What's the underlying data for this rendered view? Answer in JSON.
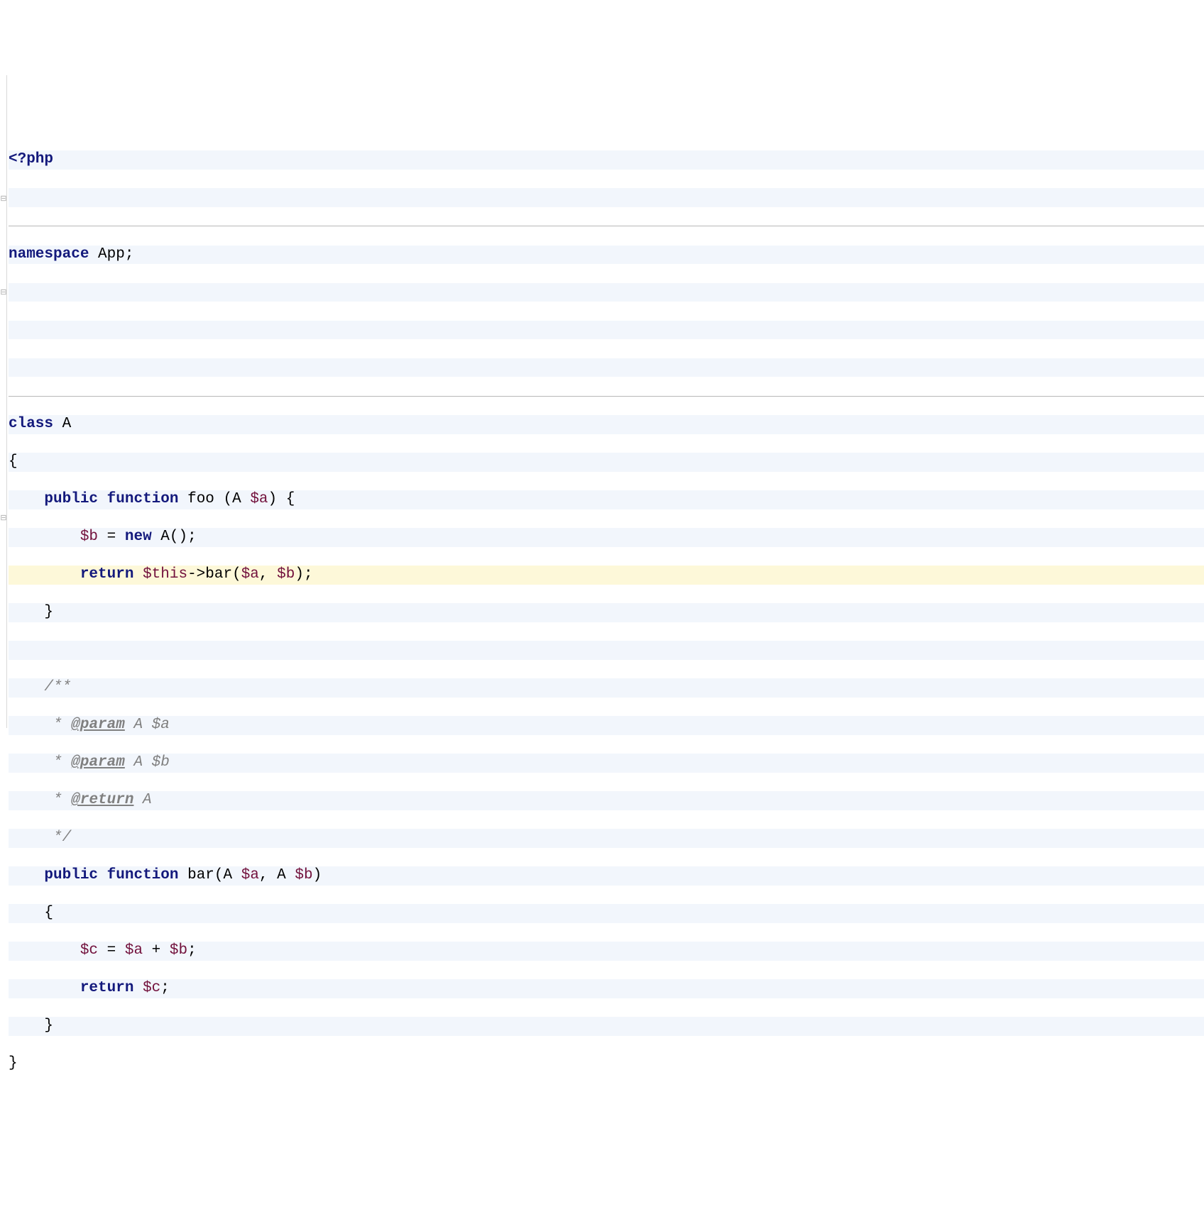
{
  "code": {
    "open_tag": "<?php",
    "ns_kw": "namespace",
    "ns_name": " App;",
    "class_kw": "class",
    "class_name": " A",
    "brace_open": "{",
    "foo_indent": "    ",
    "public_kw": "public",
    "sp": " ",
    "function_kw": "function",
    "foo_name": " foo ",
    "foo_params_open": "(A ",
    "foo_param_a": "$a",
    "foo_params_close": ") {",
    "foo_body_indent": "        ",
    "foo_b_var": "$b",
    "foo_b_eq": " = ",
    "new_kw": "new",
    "foo_b_rest": " A();",
    "return_kw": "return",
    "foo_ret_sp": " ",
    "foo_this": "$this",
    "foo_arrow": "->bar(",
    "foo_arg_a": "$a",
    "foo_comma": ", ",
    "foo_arg_b": "$b",
    "foo_call_close": ");",
    "foo_close_indent": "    ",
    "foo_close_brace": "}",
    "doc_indent": "    ",
    "doc_open": "/**",
    "doc_star_indent": "     ",
    "doc_star": "* ",
    "doc_param_tag": "@param",
    "doc_param_a": " A $a",
    "doc_param_b": " A $b",
    "doc_return_tag": "@return",
    "doc_return_val": " A",
    "doc_close_star": "*/",
    "bar_name": " bar",
    "bar_params_open": "(A ",
    "bar_param_a": "$a",
    "bar_comma": ", A ",
    "bar_param_b": "$b",
    "bar_params_close": ")",
    "bar_brace_open": "{",
    "bar_body_indent": "        ",
    "bar_c_var": "$c",
    "bar_eq": " = ",
    "bar_a": "$a",
    "bar_plus": " + ",
    "bar_b": "$b",
    "bar_semi": ";",
    "bar_ret_sp": " ",
    "bar_ret_c": "$c",
    "bar_ret_semi": ";",
    "bar_close_brace": "}",
    "class_close_brace": "}"
  }
}
